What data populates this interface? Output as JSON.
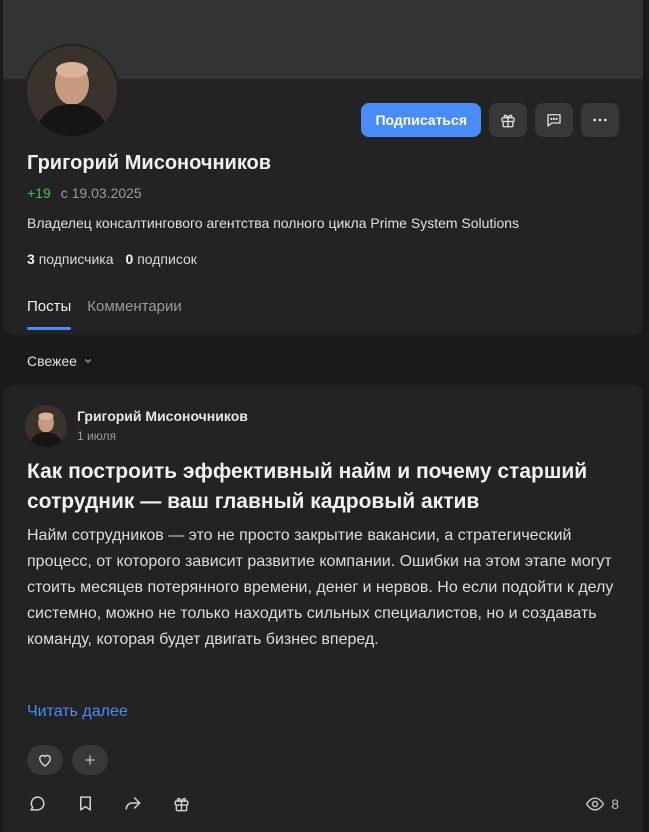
{
  "profile": {
    "name": "Григорий Мисоночников",
    "rating": "+19",
    "since": "с 19.03.2025",
    "bio": "Владелец консалтингового агентства полного цикла Prime System Solutions",
    "subscribers_count": "3",
    "subscribers_label": "подписчика",
    "subscriptions_count": "0",
    "subscriptions_label": "подписок",
    "subscribe_label": "Подписаться",
    "accent": "#4a8cf7",
    "rating_color": "#3fbf5f"
  },
  "tabs": [
    {
      "label": "Посты",
      "active": true
    },
    {
      "label": "Комментарии",
      "active": false
    }
  ],
  "sort": {
    "label": "Свежее"
  },
  "post": {
    "author": "Григорий Мисоночников",
    "date": "1 июля",
    "title": "Как построить эффективный найм и почему старший сотрудник — ваш главный кадровый актив",
    "text": "Найм сотрудников — это не просто закрытие вакансии, а стратегический процесс, от которого зависит развитие компании. Ошибки на этом этапе могут стоить месяцев потерянного времени, денег и нервов. Но если подойти к делу системно, можно не только находить сильных специалистов, но и создавать команду, которая будет двигать бизнес вперед.",
    "read_more": "Читать далее",
    "views": "8"
  },
  "icons": {
    "gift": "gift-icon",
    "message": "message-icon",
    "more": "more-icon",
    "heart": "heart-icon",
    "plus": "plus-icon",
    "comment": "comment-icon",
    "bookmark": "bookmark-icon",
    "share": "share-icon",
    "eye": "eye-icon",
    "chevron": "chevron-down-icon"
  }
}
